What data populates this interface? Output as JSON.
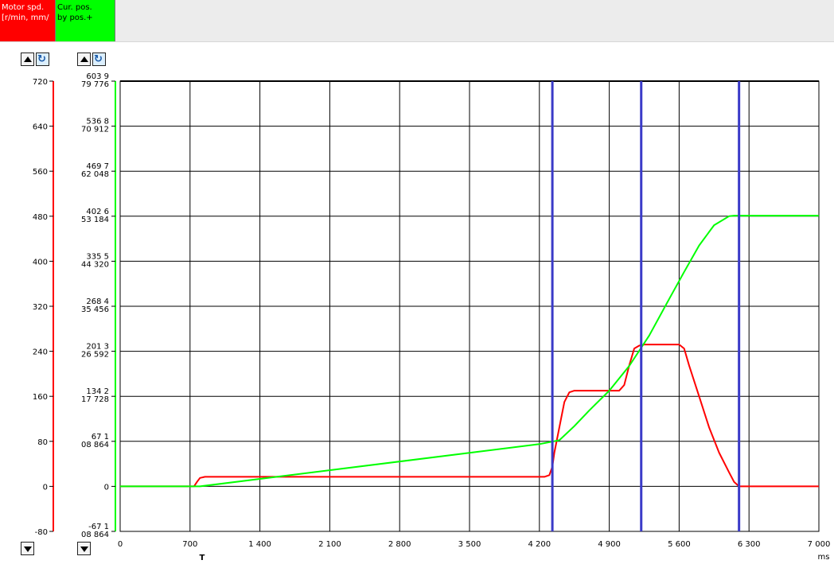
{
  "channels": [
    {
      "line1": "Motor spd.",
      "line2": "[r/min, mm/",
      "color": "#ff0000"
    },
    {
      "line1": "Cur. pos.",
      "line2": "by pos.+",
      "color": "#00ff00"
    }
  ],
  "controls": {
    "scroll_up": "triangle-up-icon",
    "reset": "reset-scale-icon",
    "scroll_down": "triangle-down-icon"
  },
  "chart_data": {
    "type": "line",
    "x_unit": "ms",
    "x_marker": "T",
    "xlim": [
      0,
      7000
    ],
    "x_ticks": [
      0,
      700,
      1400,
      2100,
      2800,
      3500,
      4200,
      4900,
      5600,
      6300,
      7000
    ],
    "x_tick_labels": [
      "0",
      "700",
      "1 400",
      "2 100",
      "2 800",
      "3 500",
      "4 200",
      "4 900",
      "5 600",
      "6 300",
      "7 000"
    ],
    "axes": [
      {
        "id": "left",
        "color": "#ff0000",
        "ylim": [
          -80,
          720
        ],
        "tick_values": [
          -80,
          0,
          80,
          160,
          240,
          320,
          400,
          480,
          560,
          640,
          720
        ],
        "tick_labels": [
          "-80",
          "0",
          "80",
          "160",
          "240",
          "320",
          "400",
          "480",
          "560",
          "640",
          "720"
        ]
      },
      {
        "id": "right",
        "color": "#00ff00",
        "ylim": [
          -80,
          720
        ],
        "tick_values": [
          -80,
          0,
          80,
          160,
          240,
          320,
          400,
          480,
          560,
          640,
          720
        ],
        "tick_labels": [
          [
            "-67 1",
            "08 864"
          ],
          [
            "0",
            ""
          ],
          [
            "67 1",
            "08 864"
          ],
          [
            "134 2",
            "17 728"
          ],
          [
            "201 3",
            "26 592"
          ],
          [
            "268 4",
            "35 456"
          ],
          [
            "335 5",
            "44 320"
          ],
          [
            "402 6",
            "53 184"
          ],
          [
            "469 7",
            "62 048"
          ],
          [
            "536 8",
            "70 912"
          ],
          [
            "603 9",
            "79 776"
          ]
        ]
      }
    ],
    "series": [
      {
        "axis": "left",
        "color": "#ff0000",
        "x": [
          0,
          700,
          740,
          770,
          800,
          850,
          900,
          1000,
          4250,
          4300,
          4330,
          4350,
          4450,
          4500,
          4550,
          4800,
          5000,
          5050,
          5100,
          5150,
          5200,
          5250,
          5600,
          5650,
          5700,
          5800,
          5900,
          6000,
          6100,
          6150,
          6200,
          7000
        ],
        "y": [
          0,
          0,
          0,
          8,
          15,
          17,
          17,
          17,
          17,
          20,
          35,
          60,
          150,
          167,
          170,
          170,
          170,
          180,
          215,
          245,
          250,
          252,
          252,
          245,
          215,
          160,
          105,
          60,
          25,
          8,
          0,
          0
        ]
      },
      {
        "axis": "left",
        "color": "#00ff00",
        "x": [
          0,
          700,
          800,
          4200,
          4400,
          4550,
          4700,
          4900,
          5100,
          5300,
          5500,
          5650,
          5800,
          5950,
          6100,
          6150,
          6300,
          7000
        ],
        "y": [
          0,
          0,
          0,
          75,
          82,
          107,
          135,
          170,
          214,
          268,
          333,
          381,
          428,
          464,
          480,
          481,
          481,
          481
        ]
      }
    ],
    "cursors": {
      "color": "#3a3ac8",
      "x": [
        4330,
        5220,
        6200
      ]
    },
    "grid": true
  }
}
